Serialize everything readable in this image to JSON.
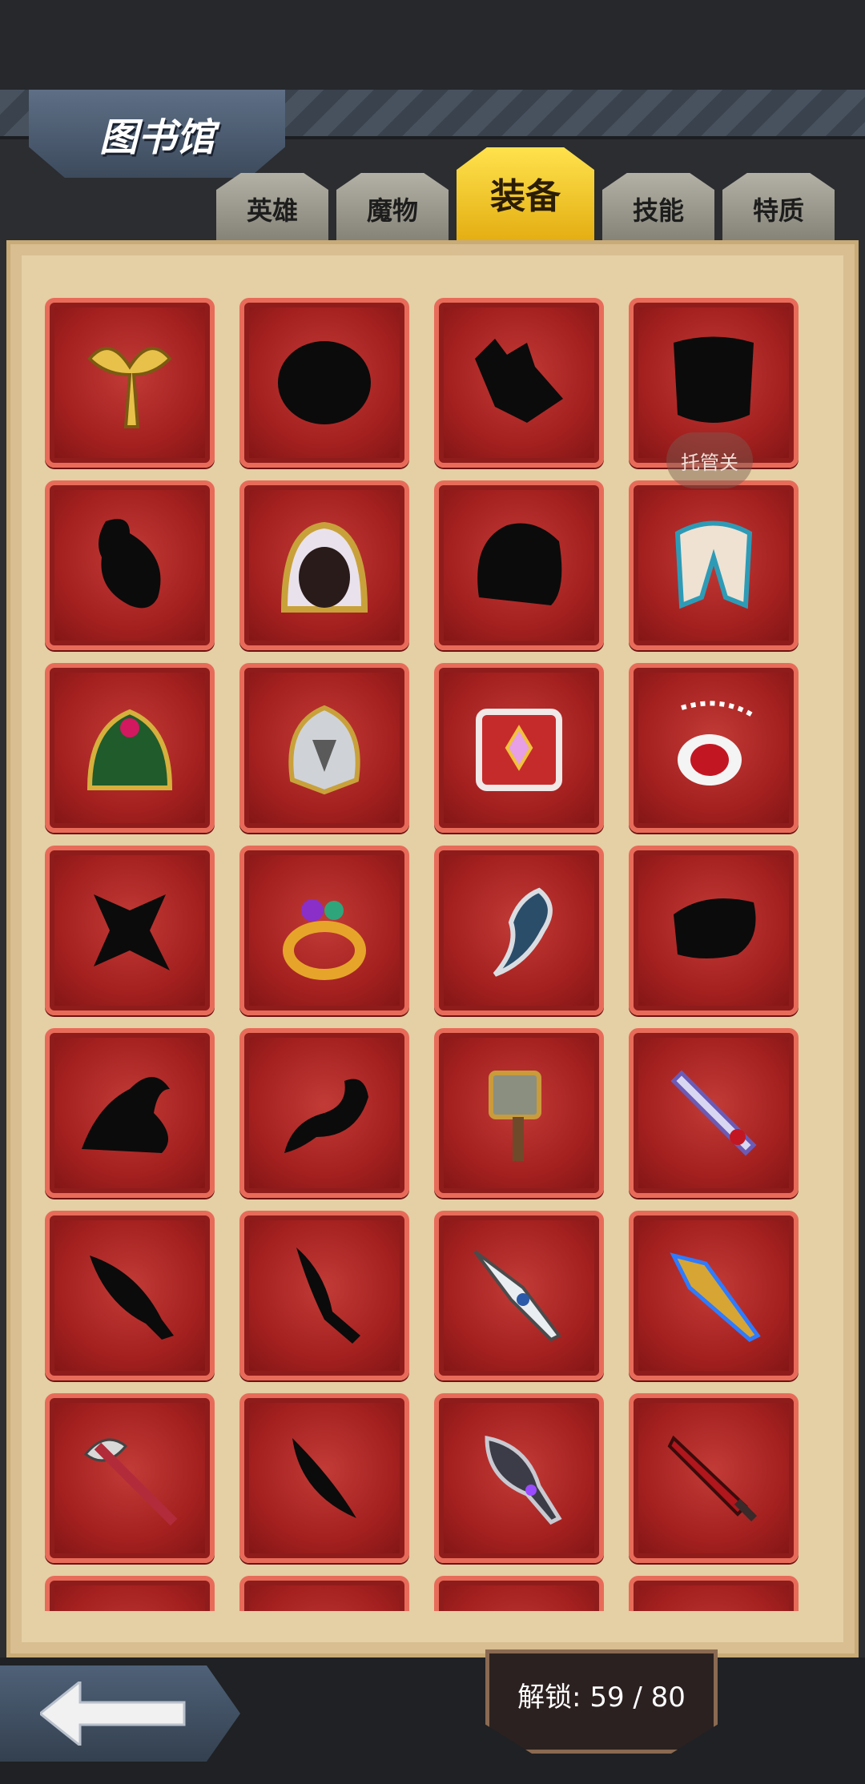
{
  "header": {
    "title": "图书馆"
  },
  "tabs": [
    {
      "label": "英雄",
      "active": false
    },
    {
      "label": "魔物",
      "active": false
    },
    {
      "label": "装备",
      "active": true
    },
    {
      "label": "技能",
      "active": false
    },
    {
      "label": "特质",
      "active": false
    }
  ],
  "tooltip": "托管关",
  "footer": {
    "unlock_text": "解锁: 59 / 80"
  },
  "items": [
    {
      "icon": "winged-staff-icon",
      "unlocked": true
    },
    {
      "icon": "locked-shield-icon",
      "unlocked": false
    },
    {
      "icon": "locked-boots-icon",
      "unlocked": false
    },
    {
      "icon": "locked-cape-icon",
      "unlocked": false
    },
    {
      "icon": "locked-gourd-icon",
      "unlocked": false
    },
    {
      "icon": "golden-hood-icon",
      "unlocked": true
    },
    {
      "icon": "locked-armor-icon",
      "unlocked": false
    },
    {
      "icon": "mantle-icon",
      "unlocked": true
    },
    {
      "icon": "green-dragon-armor-icon",
      "unlocked": true
    },
    {
      "icon": "knight-helmet-icon",
      "unlocked": true
    },
    {
      "icon": "spell-book-icon",
      "unlocked": true
    },
    {
      "icon": "ruby-amulet-icon",
      "unlocked": true
    },
    {
      "icon": "locked-shuriken-icon",
      "unlocked": false
    },
    {
      "icon": "gem-ring-icon",
      "unlocked": true
    },
    {
      "icon": "claw-gauntlet-icon",
      "unlocked": true
    },
    {
      "icon": "locked-gloves-icon",
      "unlocked": false
    },
    {
      "icon": "locked-hat-icon",
      "unlocked": false
    },
    {
      "icon": "locked-dragon-icon",
      "unlocked": false
    },
    {
      "icon": "war-hammer-icon",
      "unlocked": true
    },
    {
      "icon": "crystal-sword-icon",
      "unlocked": true
    },
    {
      "icon": "locked-dagger-icon",
      "unlocked": false
    },
    {
      "icon": "locked-blade-icon",
      "unlocked": false
    },
    {
      "icon": "spear-icon",
      "unlocked": true
    },
    {
      "icon": "lightning-spear-icon",
      "unlocked": true
    },
    {
      "icon": "battle-axe-icon",
      "unlocked": true
    },
    {
      "icon": "locked-scimitar-icon",
      "unlocked": false
    },
    {
      "icon": "dark-blade-icon",
      "unlocked": true
    },
    {
      "icon": "crimson-sword-icon",
      "unlocked": true
    },
    {
      "icon": "partial-item-icon",
      "unlocked": false
    },
    {
      "icon": "partial-item-icon",
      "unlocked": false
    },
    {
      "icon": "partial-item-icon",
      "unlocked": false
    },
    {
      "icon": "partial-item-icon",
      "unlocked": false
    }
  ]
}
